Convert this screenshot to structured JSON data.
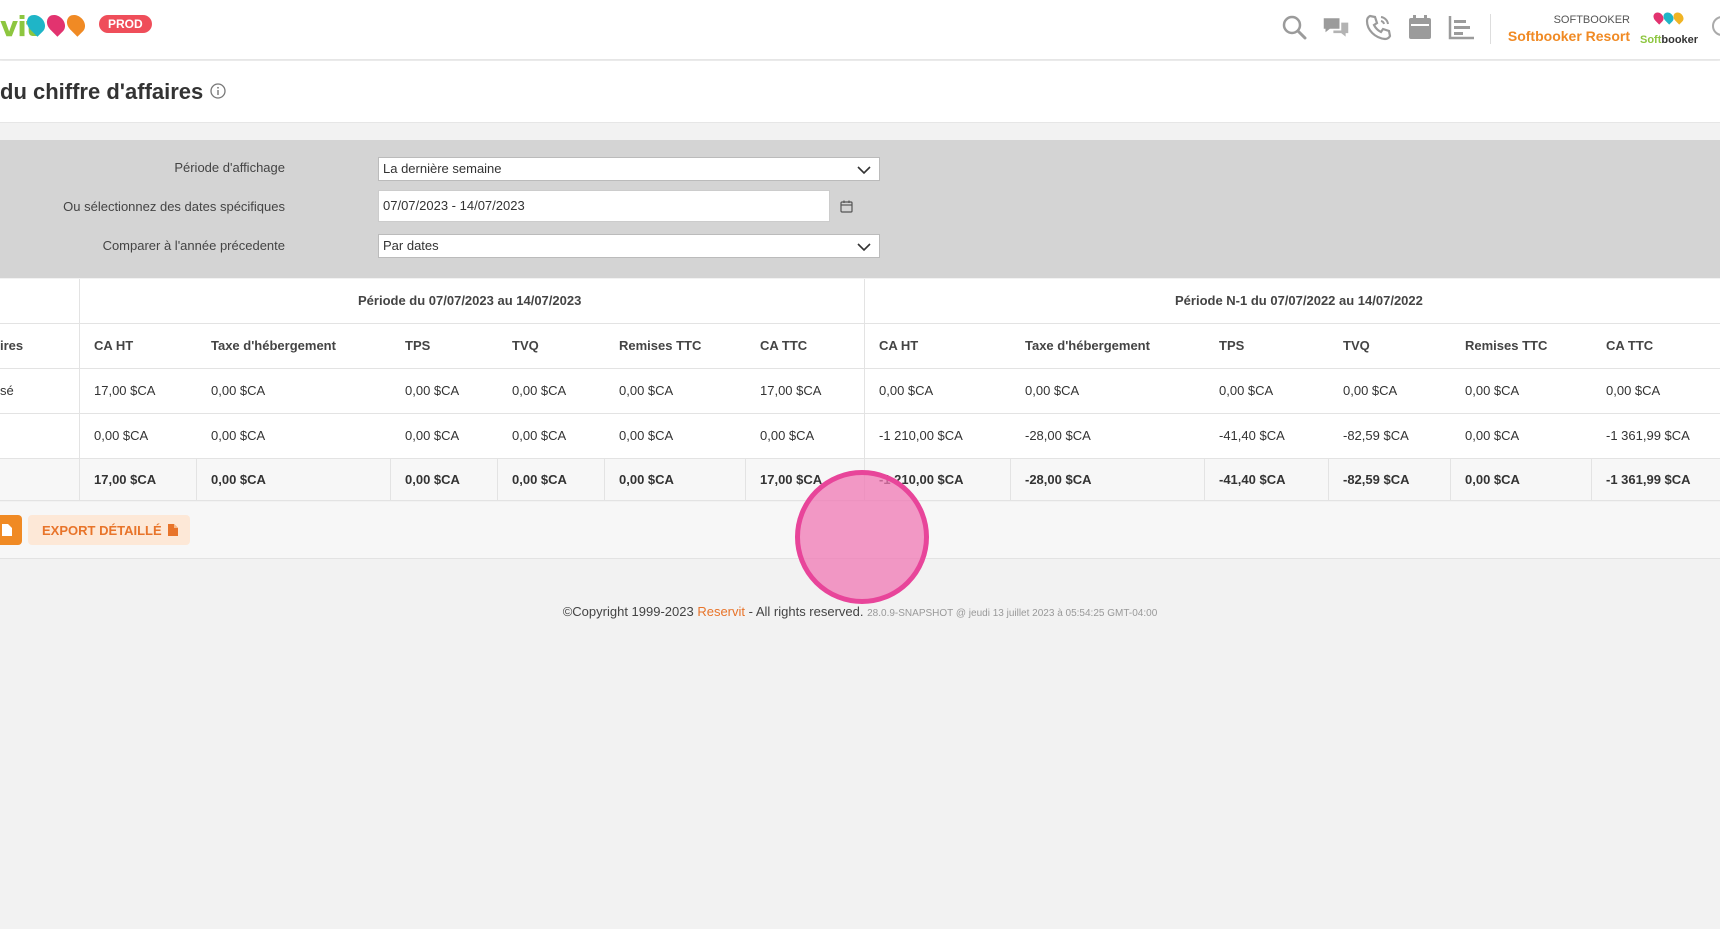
{
  "header": {
    "logo_text": "vit",
    "env_badge": "PROD",
    "account_label": "SOFTBOOKER",
    "account_name": "Softbooker Resort",
    "brand_logo_part1": "Soft",
    "brand_logo_part2": "booker",
    "icons": [
      "search-icon",
      "chat-icon",
      "phone-icon",
      "calendar-icon",
      "report-icon"
    ]
  },
  "page": {
    "title": "du chiffre d'affaires"
  },
  "filters": {
    "period_label": "Période d'affichage",
    "period_value": "La dernière semaine",
    "dates_label": "Ou sélectionnez des dates spécifiques",
    "dates_value": "07/07/2023 - 14/07/2023",
    "compare_label": "Comparer à l'année précedente",
    "compare_value": "Par dates"
  },
  "table": {
    "group_current": "Période du 07/07/2023 au 14/07/2023",
    "group_previous": "Période N-1 du 07/07/2022 au 14/07/2022",
    "first_col_header": "ires",
    "columns": [
      "CA HT",
      "Taxe d'hébergement",
      "TPS",
      "TVQ",
      "Remises TTC",
      "CA TTC",
      "CA HT",
      "Taxe d'hébergement",
      "TPS",
      "TVQ",
      "Remises TTC",
      "CA TTC"
    ],
    "rows": [
      {
        "label": "sé",
        "values": [
          "17,00 $CA",
          "0,00 $CA",
          "0,00 $CA",
          "0,00 $CA",
          "0,00 $CA",
          "17,00 $CA",
          "0,00 $CA",
          "0,00 $CA",
          "0,00 $CA",
          "0,00 $CA",
          "0,00 $CA",
          "0,00 $CA"
        ]
      },
      {
        "label": "",
        "values": [
          "0,00 $CA",
          "0,00 $CA",
          "0,00 $CA",
          "0,00 $CA",
          "0,00 $CA",
          "0,00 $CA",
          "-1 210,00 $CA",
          "-28,00 $CA",
          "-41,40 $CA",
          "-82,59 $CA",
          "0,00 $CA",
          "-1 361,99 $CA"
        ]
      }
    ],
    "total": [
      "17,00 $CA",
      "0,00 $CA",
      "0,00 $CA",
      "0,00 $CA",
      "0,00 $CA",
      "17,00 $CA",
      "-1 210,00 $CA",
      "-28,00 $CA",
      "-41,40 $CA",
      "-82,59 $CA",
      "0,00 $CA",
      "-1 361,99 $CA"
    ]
  },
  "actions": {
    "export_detailed": "EXPORT DÉTAILLÉ"
  },
  "footer": {
    "copyright": "©Copyright 1999-2023 ",
    "brand": "Reservit",
    "rights": " - All rights reserved. ",
    "version": "28.0.9-SNAPSHOT @ jeudi 13 juillet 2023 à 05:54:25 GMT-04:00"
  },
  "colors": {
    "accent_orange": "#f08a24",
    "brand_green": "#8dc63f",
    "prod_red": "#ef4e5a",
    "highlight_pink": "#e8459a"
  }
}
